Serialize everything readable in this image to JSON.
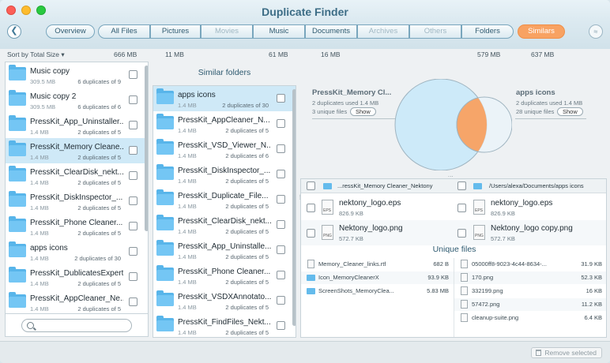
{
  "window": {
    "title": "Duplicate Finder"
  },
  "toolbar": {
    "tabs": [
      {
        "label": "Overview",
        "size": "",
        "state": "normal"
      },
      {
        "label": "All Files",
        "size": "666 MB",
        "state": "normal"
      },
      {
        "label": "Pictures",
        "size": "11 MB",
        "state": "normal"
      },
      {
        "label": "Movies",
        "size": "",
        "state": "disabled"
      },
      {
        "label": "Music",
        "size": "61 MB",
        "state": "normal"
      },
      {
        "label": "Documents",
        "size": "16 MB",
        "state": "normal"
      },
      {
        "label": "Archives",
        "size": "",
        "state": "disabled"
      },
      {
        "label": "Others",
        "size": "",
        "state": "disabled"
      },
      {
        "label": "Folders",
        "size": "579 MB",
        "state": "normal"
      },
      {
        "label": "Similars",
        "size": "637 MB",
        "state": "active"
      }
    ]
  },
  "sort": {
    "label": "Sort by Total Size"
  },
  "left_list": [
    {
      "name": "Music copy",
      "size": "309.5 MB",
      "dups": "6 duplicates of 9",
      "selected": false
    },
    {
      "name": "Music copy 2",
      "size": "309.5 MB",
      "dups": "6 duplicates of 6",
      "selected": false
    },
    {
      "name": "PressKit_App_Uninstaller...",
      "size": "1.4 MB",
      "dups": "2 duplicates of 5",
      "selected": false
    },
    {
      "name": "PressKit_Memory Cleane...",
      "size": "1.4 MB",
      "dups": "2 duplicates of 5",
      "selected": true
    },
    {
      "name": "PressKit_ClearDisk_nekt...",
      "size": "1.4 MB",
      "dups": "2 duplicates of 5",
      "selected": false
    },
    {
      "name": "PressKit_DiskInspector_...",
      "size": "1.4 MB",
      "dups": "2 duplicates of 5",
      "selected": false
    },
    {
      "name": "PressKit_Phone Cleaner...",
      "size": "1.4 MB",
      "dups": "2 duplicates of 5",
      "selected": false
    },
    {
      "name": "apps icons",
      "size": "1.4 MB",
      "dups": "2 duplicates of 30",
      "selected": false
    },
    {
      "name": "PressKit_DublicatesExpert",
      "size": "1.4 MB",
      "dups": "2 duplicates of 5",
      "selected": false
    },
    {
      "name": "PressKit_AppCleaner_Ne...",
      "size": "1.4 MB",
      "dups": "2 duplicates of 5",
      "selected": false
    }
  ],
  "similar_folders": {
    "title": "Similar folders",
    "items": [
      {
        "name": "apps icons",
        "size": "1.4 MB",
        "dups": "2 duplicates of 30",
        "selected": true
      },
      {
        "name": "PressKit_AppCleaner_N...",
        "size": "1.4 MB",
        "dups": "2 duplicates of 5",
        "selected": false
      },
      {
        "name": "PressKit_VSD_Viewer_N...",
        "size": "1.4 MB",
        "dups": "2 duplicates of 6",
        "selected": false
      },
      {
        "name": "PressKit_DiskInspector_...",
        "size": "1.4 MB",
        "dups": "2 duplicates of 5",
        "selected": false
      },
      {
        "name": "PressKit_Duplicate_File...",
        "size": "1.4 MB",
        "dups": "2 duplicates of 5",
        "selected": false
      },
      {
        "name": "PressKit_ClearDisk_nekt...",
        "size": "1.4 MB",
        "dups": "2 duplicates of 5",
        "selected": false
      },
      {
        "name": "PressKit_App_Uninstalle...",
        "size": "1.4 MB",
        "dups": "2 duplicates of 5",
        "selected": false
      },
      {
        "name": "PressKit_Phone Cleaner...",
        "size": "1.4 MB",
        "dups": "2 duplicates of 5",
        "selected": false
      },
      {
        "name": "PressKit_VSDXAnnotato...",
        "size": "1.4 MB",
        "dups": "2 duplicates of 5",
        "selected": false
      },
      {
        "name": "PressKit_FindFiles_Nekt...",
        "size": "1.4 MB",
        "dups": "2 duplicates of 5",
        "selected": false
      }
    ]
  },
  "venn": {
    "left": {
      "name": "PressKit_Memory Cl...",
      "dups": "2 duplicates used 1.4 MB",
      "unique": "3 unique files",
      "show": "Show"
    },
    "right": {
      "name": "apps icons",
      "dups": "2 duplicates used 1.4 MB",
      "unique": "28 unique files",
      "show": "Show"
    },
    "colors": {
      "left": "#cdeaf9",
      "right": "#eaf5fb",
      "overlap": "#f6a569"
    }
  },
  "compare": {
    "left_path": "...ressKit_Memory Cleaner_Nektony",
    "right_path": "/Users/alexa/Documents/apps icons",
    "duplicates": [
      {
        "left_name": "nektony_logo.eps",
        "left_size": "826.9 KB",
        "left_ext": "EPS",
        "right_name": "nektony_logo.eps",
        "right_size": "826.9 KB",
        "right_ext": "EPS"
      },
      {
        "left_name": "Nektony_logo.png",
        "left_size": "572.7 KB",
        "left_ext": "PNG",
        "right_name": "Nektony_logo copy.png",
        "right_size": "572.7 KB",
        "right_ext": "PNG"
      }
    ],
    "unique_title": "Unique files",
    "unique_left": [
      {
        "name": "Memory_Cleaner_links.rtf",
        "size": "682 B",
        "kind": "file"
      },
      {
        "name": "Icon_MemoryCleanerX",
        "size": "93.9 KB",
        "kind": "folder"
      },
      {
        "name": "ScreenShots_MemoryClea...",
        "size": "5.83 MB",
        "kind": "folder"
      }
    ],
    "unique_right": [
      {
        "name": "05000ff8-9023-4c44-8634-...",
        "size": "31.9 KB",
        "kind": "file"
      },
      {
        "name": "170.png",
        "size": "52.3 KB",
        "kind": "file"
      },
      {
        "name": "332199.png",
        "size": "16 KB",
        "kind": "file"
      },
      {
        "name": "57472.png",
        "size": "11.2 KB",
        "kind": "file"
      },
      {
        "name": "cleanup-suite.png",
        "size": "6.4 KB",
        "kind": "file"
      }
    ]
  },
  "footer": {
    "remove_label": "Remove selected"
  }
}
